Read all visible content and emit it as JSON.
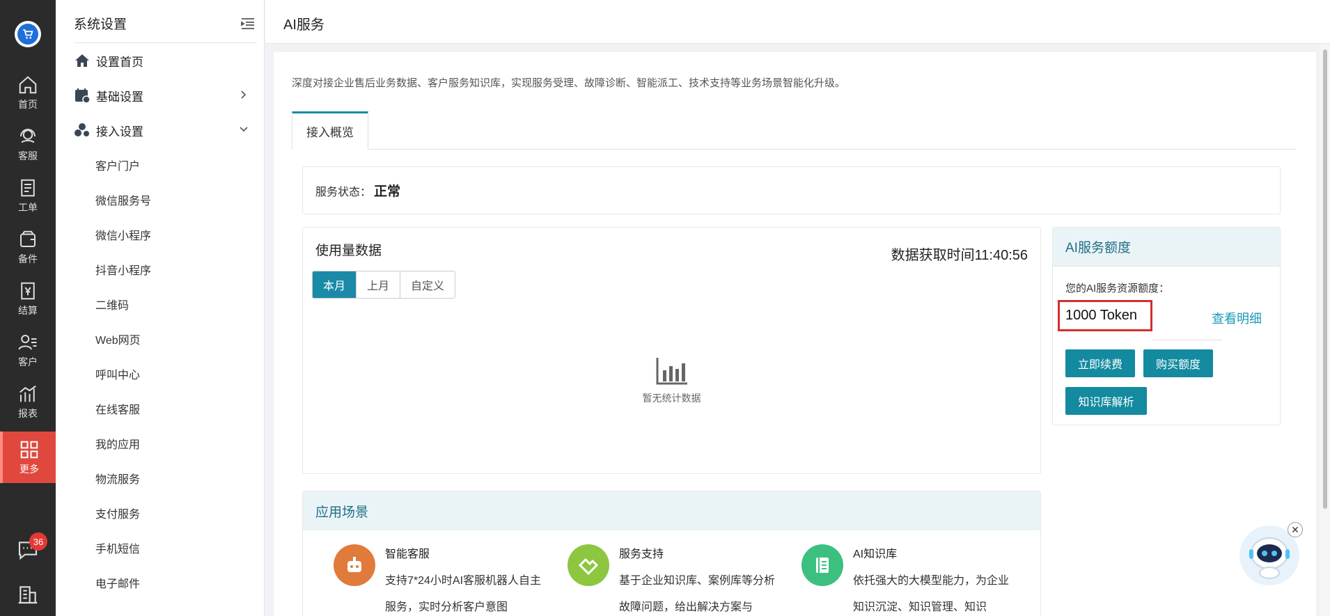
{
  "rail": {
    "items": [
      {
        "label": "首页",
        "icon": "home-icon"
      },
      {
        "label": "客服",
        "icon": "headset-icon"
      },
      {
        "label": "工单",
        "icon": "ticket-icon"
      },
      {
        "label": "备件",
        "icon": "box-icon"
      },
      {
        "label": "结算",
        "icon": "yen-icon"
      },
      {
        "label": "客户",
        "icon": "users-icon"
      },
      {
        "label": "报表",
        "icon": "chart-icon"
      },
      {
        "label": "更多",
        "icon": "grid-icon"
      }
    ],
    "badge": "36"
  },
  "submenu": {
    "title": "系统设置",
    "home": "设置首页",
    "basic": "基础设置",
    "access": "接入设置",
    "items": [
      "客户门户",
      "微信服务号",
      "微信小程序",
      "抖音小程序",
      "二维码",
      "Web网页",
      "呼叫中心",
      "在线客服",
      "我的应用",
      "物流服务",
      "支付服务",
      "手机短信",
      "电子邮件"
    ]
  },
  "header": {
    "title": "AI服务"
  },
  "main": {
    "description": "深度对接企业售后业务数据、客户服务知识库，实现服务受理、故障诊断、智能派工、技术支持等业务场景智能化升级。",
    "tab": "接入概览",
    "status_label": "服务状态：",
    "status_value": "正常",
    "usage": {
      "title": "使用量数据",
      "time": "数据获取时间11:40:56",
      "periods": [
        "本月",
        "上月",
        "自定义"
      ],
      "empty": "暂无统计数据"
    },
    "quota": {
      "title": "AI服务额度",
      "label": "您的AI服务资源额度：",
      "value": "1000 Token",
      "detail": "查看明细",
      "renew": "立即续费",
      "buy": "购买额度",
      "kb": "知识库解析"
    },
    "scenes": {
      "title": "应用场景",
      "items": [
        {
          "name": "智能客服",
          "desc": "支持7*24小时AI客服机器人自主服务，实时分析客户意图",
          "color": "#e07b3c"
        },
        {
          "name": "服务支持",
          "desc": "基于企业知识库、案例库等分析故障问题，给出解决方案与",
          "color": "#8dc63f"
        },
        {
          "name": "AI知识库",
          "desc": "依托强大的大模型能力，为企业知识沉淀、知识管理、知识",
          "color": "#3cc07f"
        }
      ]
    }
  }
}
